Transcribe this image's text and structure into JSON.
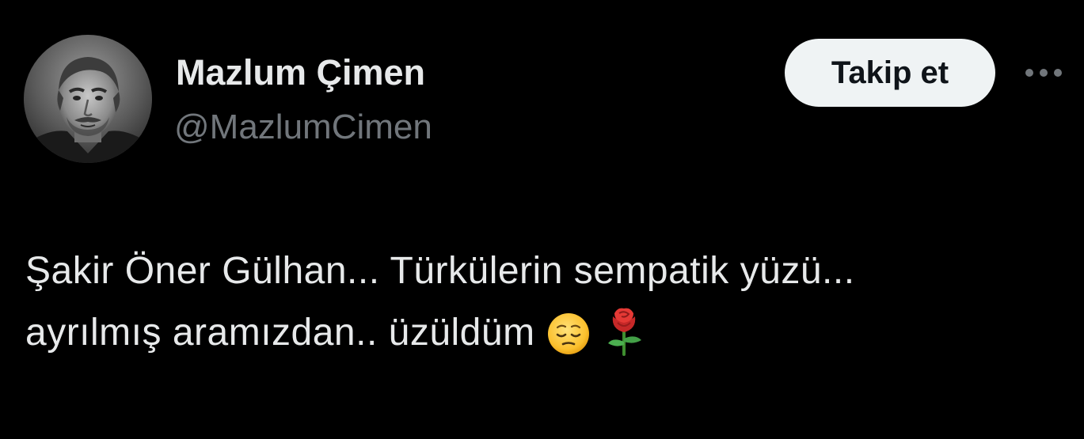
{
  "author": {
    "display_name": "Mazlum Çimen",
    "handle": "@MazlumCimen",
    "avatar_icon": "profile-photo"
  },
  "actions": {
    "follow_label": "Takip et",
    "more_icon": "more-dots-icon"
  },
  "tweet": {
    "line1": "Şakir Öner Gülhan... Türkülerin sempatik yüzü...",
    "line2": "ayrılmış aramızdan.. üzüldüm",
    "emojis": [
      "pensive-face-emoji",
      "rose-emoji"
    ]
  },
  "colors": {
    "background": "#000000",
    "text_primary": "#e7e9ea",
    "text_secondary": "#71767b",
    "button_bg": "#eff3f4",
    "button_text": "#0f1419"
  }
}
